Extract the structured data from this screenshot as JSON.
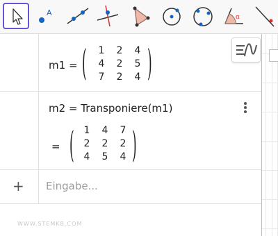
{
  "toolbar": {
    "tools": [
      {
        "icon": "move-pointer-icon"
      },
      {
        "icon": "point-icon"
      },
      {
        "icon": "line-icon"
      },
      {
        "icon": "perpendicular-line-icon"
      },
      {
        "icon": "polygon-icon"
      },
      {
        "icon": "circle-center-point-icon"
      },
      {
        "icon": "circle-three-points-icon"
      },
      {
        "icon": "angle-icon"
      },
      {
        "icon": "reflect-icon"
      }
    ],
    "angle_symbol": "α",
    "accent": "#6557d2",
    "point_color": "#1565c0",
    "red": "#d32f2f"
  },
  "algebra": {
    "m1": {
      "name": "m1",
      "equals": "=",
      "rows": [
        [
          "1",
          "2",
          "4"
        ],
        [
          "4",
          "2",
          "5"
        ],
        [
          "7",
          "2",
          "4"
        ]
      ]
    },
    "m2": {
      "definition": "m2 = Transponiere(m1)",
      "equals": "=",
      "rows": [
        [
          "1",
          "4",
          "7"
        ],
        [
          "2",
          "2",
          "2"
        ],
        [
          "4",
          "5",
          "4"
        ]
      ]
    },
    "input": {
      "plus": "+",
      "placeholder": "Eingabe..."
    }
  },
  "watermark": "WWW.STEMKB.COM"
}
